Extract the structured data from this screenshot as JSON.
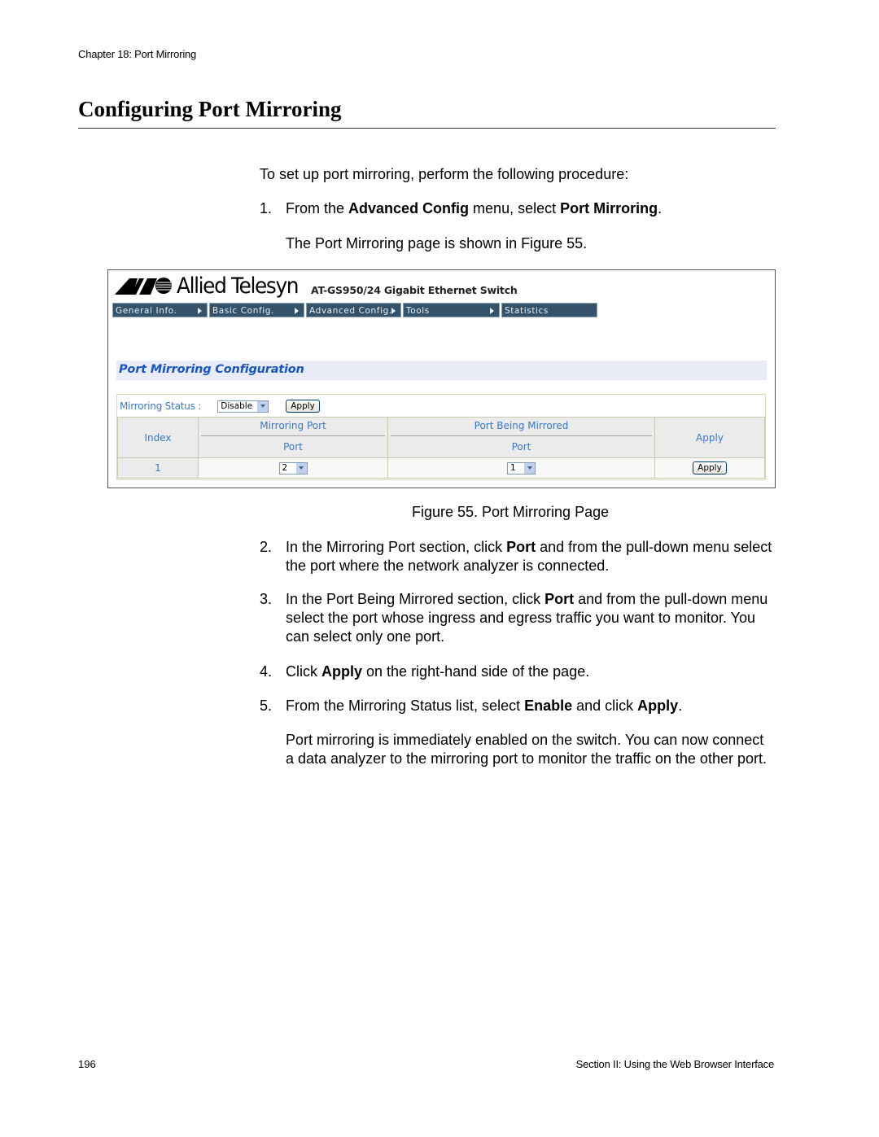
{
  "header": {
    "running_head": "Chapter 18: Port Mirroring",
    "title": "Configuring Port Mirroring"
  },
  "intro": "To set up port mirroring, perform the following procedure:",
  "steps": [
    {
      "number": "1.",
      "parts": [
        {
          "text": "From the ",
          "bold": false
        },
        {
          "text": "Advanced Config",
          "bold": true
        },
        {
          "text": " menu, select ",
          "bold": false
        },
        {
          "text": "Port Mirroring",
          "bold": true
        },
        {
          "text": ".",
          "bold": false
        }
      ],
      "note": "The Port Mirroring page is shown in Figure 55."
    },
    {
      "number": "2.",
      "parts": [
        {
          "text": "In the Mirroring Port section, click ",
          "bold": false
        },
        {
          "text": "Port",
          "bold": true
        },
        {
          "text": " and from the pull-down menu select the port where the network analyzer is connected.",
          "bold": false
        }
      ]
    },
    {
      "number": "3.",
      "parts": [
        {
          "text": "In the Port Being Mirrored section, click ",
          "bold": false
        },
        {
          "text": "Port",
          "bold": true
        },
        {
          "text": " and from the pull-down menu select the port whose ingress and egress traffic you want to monitor. You can select only one port.",
          "bold": false
        }
      ]
    },
    {
      "number": "4.",
      "parts": [
        {
          "text": "Click ",
          "bold": false
        },
        {
          "text": "Apply",
          "bold": true
        },
        {
          "text": " on the right-hand side of the page.",
          "bold": false
        }
      ]
    },
    {
      "number": "5.",
      "parts": [
        {
          "text": "From the Mirroring Status list, select ",
          "bold": false
        },
        {
          "text": "Enable",
          "bold": true
        },
        {
          "text": " and click ",
          "bold": false
        },
        {
          "text": "Apply",
          "bold": true
        },
        {
          "text": ".",
          "bold": false
        }
      ],
      "note": "Port mirroring is immediately enabled on the switch. You can now connect a data analyzer to the mirroring port to monitor the traffic on the other port."
    }
  ],
  "figure": {
    "caption": "Figure 55. Port Mirroring Page",
    "brand": "Allied Telesyn",
    "product": "AT-GS950/24 Gigabit Ethernet Switch",
    "nav": [
      {
        "label": "General Info.",
        "icon": "triangle-right-icon"
      },
      {
        "label": "Basic Config.",
        "icon": "triangle-right-icon"
      },
      {
        "label": "Advanced Config.",
        "icon": "triangle-right-icon"
      },
      {
        "label": "Tools",
        "icon": "triangle-right-icon"
      },
      {
        "label": "Statistics"
      }
    ],
    "section_title": "Port Mirroring Configuration",
    "status_label": "Mirroring Status :",
    "status_value": "Disable",
    "status_apply": "Apply",
    "table": {
      "index_header": "Index",
      "mirroring_port_header": "Mirroring Port",
      "mirroring_port_sub": "Port",
      "mirrored_header": "Port Being Mirrored",
      "mirrored_sub": "Port",
      "apply_header": "Apply",
      "rows": [
        {
          "index": "1",
          "mirroring_port": "2",
          "mirrored_port": "1",
          "apply": "Apply"
        }
      ]
    },
    "colors": {
      "nav_bg": "#34536b",
      "section_title": "#1755c4",
      "label_blue": "#3a78c8",
      "section_bar": "#e9ecf6"
    }
  },
  "footer": {
    "page_number": "196",
    "section": "Section II: Using the Web Browser Interface"
  }
}
